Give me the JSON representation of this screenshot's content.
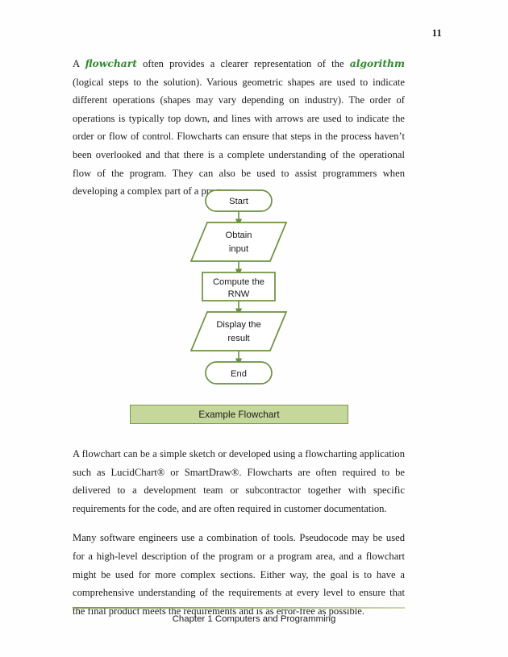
{
  "document": {
    "page_number": "11",
    "paragraph1": {
      "segments": [
        {
          "text": "A ",
          "style": "normal"
        },
        {
          "text": "flowchart",
          "style": "keyword"
        },
        {
          "text": " often provides a clearer representation of the ",
          "style": "normal"
        },
        {
          "text": "algorithm",
          "style": "keyword"
        },
        {
          "text": " (logical steps to the solution).  Various geometric shapes are used to indicate different operations (shapes may vary depending on industry).  The order of operations is typically top down, and lines with arrows are used to indicate the order or flow of control.  Flowcharts can ensure that steps in the process haven’t been overlooked and that there is a complete understanding of the operational flow of the program.  They can also be used to assist programmers when developing a complex part of a program.",
          "style": "normal"
        }
      ]
    },
    "paragraph2": "A flowchart can be a simple sketch or developed using a flowcharting application such as LucidChart® or SmartDraw®.  Flowcharts are often required to be delivered to a development team or subcontractor together with specific requirements for the code, and are often required in customer documentation.",
    "paragraph3": "Many software engineers use a combination of tools.  Pseudocode may be used for a high-level description of the program or a program area, and a flowchart might be used for more complex sections.  Either way, the goal is to have a comprehensive understanding of the requirements at every level to ensure that the final product meets the requirements and is as error-free as possible.",
    "footer": "Chapter 1 Computers and Programming"
  },
  "figure": {
    "caption": "Example Flowchart",
    "caption_fill": "#c5d79a",
    "caption_border": "#7e9a4e",
    "shape_stroke": "#6b9141",
    "nodes": [
      {
        "id": "start",
        "shape": "terminator",
        "line1": "Start",
        "line2": ""
      },
      {
        "id": "input",
        "shape": "parallelogram",
        "line1": "Obtain",
        "line2": "input"
      },
      {
        "id": "process",
        "shape": "rectangle",
        "line1": "Compute the",
        "line2": "RNW"
      },
      {
        "id": "output",
        "shape": "parallelogram",
        "line1": "Display the",
        "line2": "result"
      },
      {
        "id": "end",
        "shape": "terminator",
        "line1": "End",
        "line2": ""
      }
    ]
  }
}
